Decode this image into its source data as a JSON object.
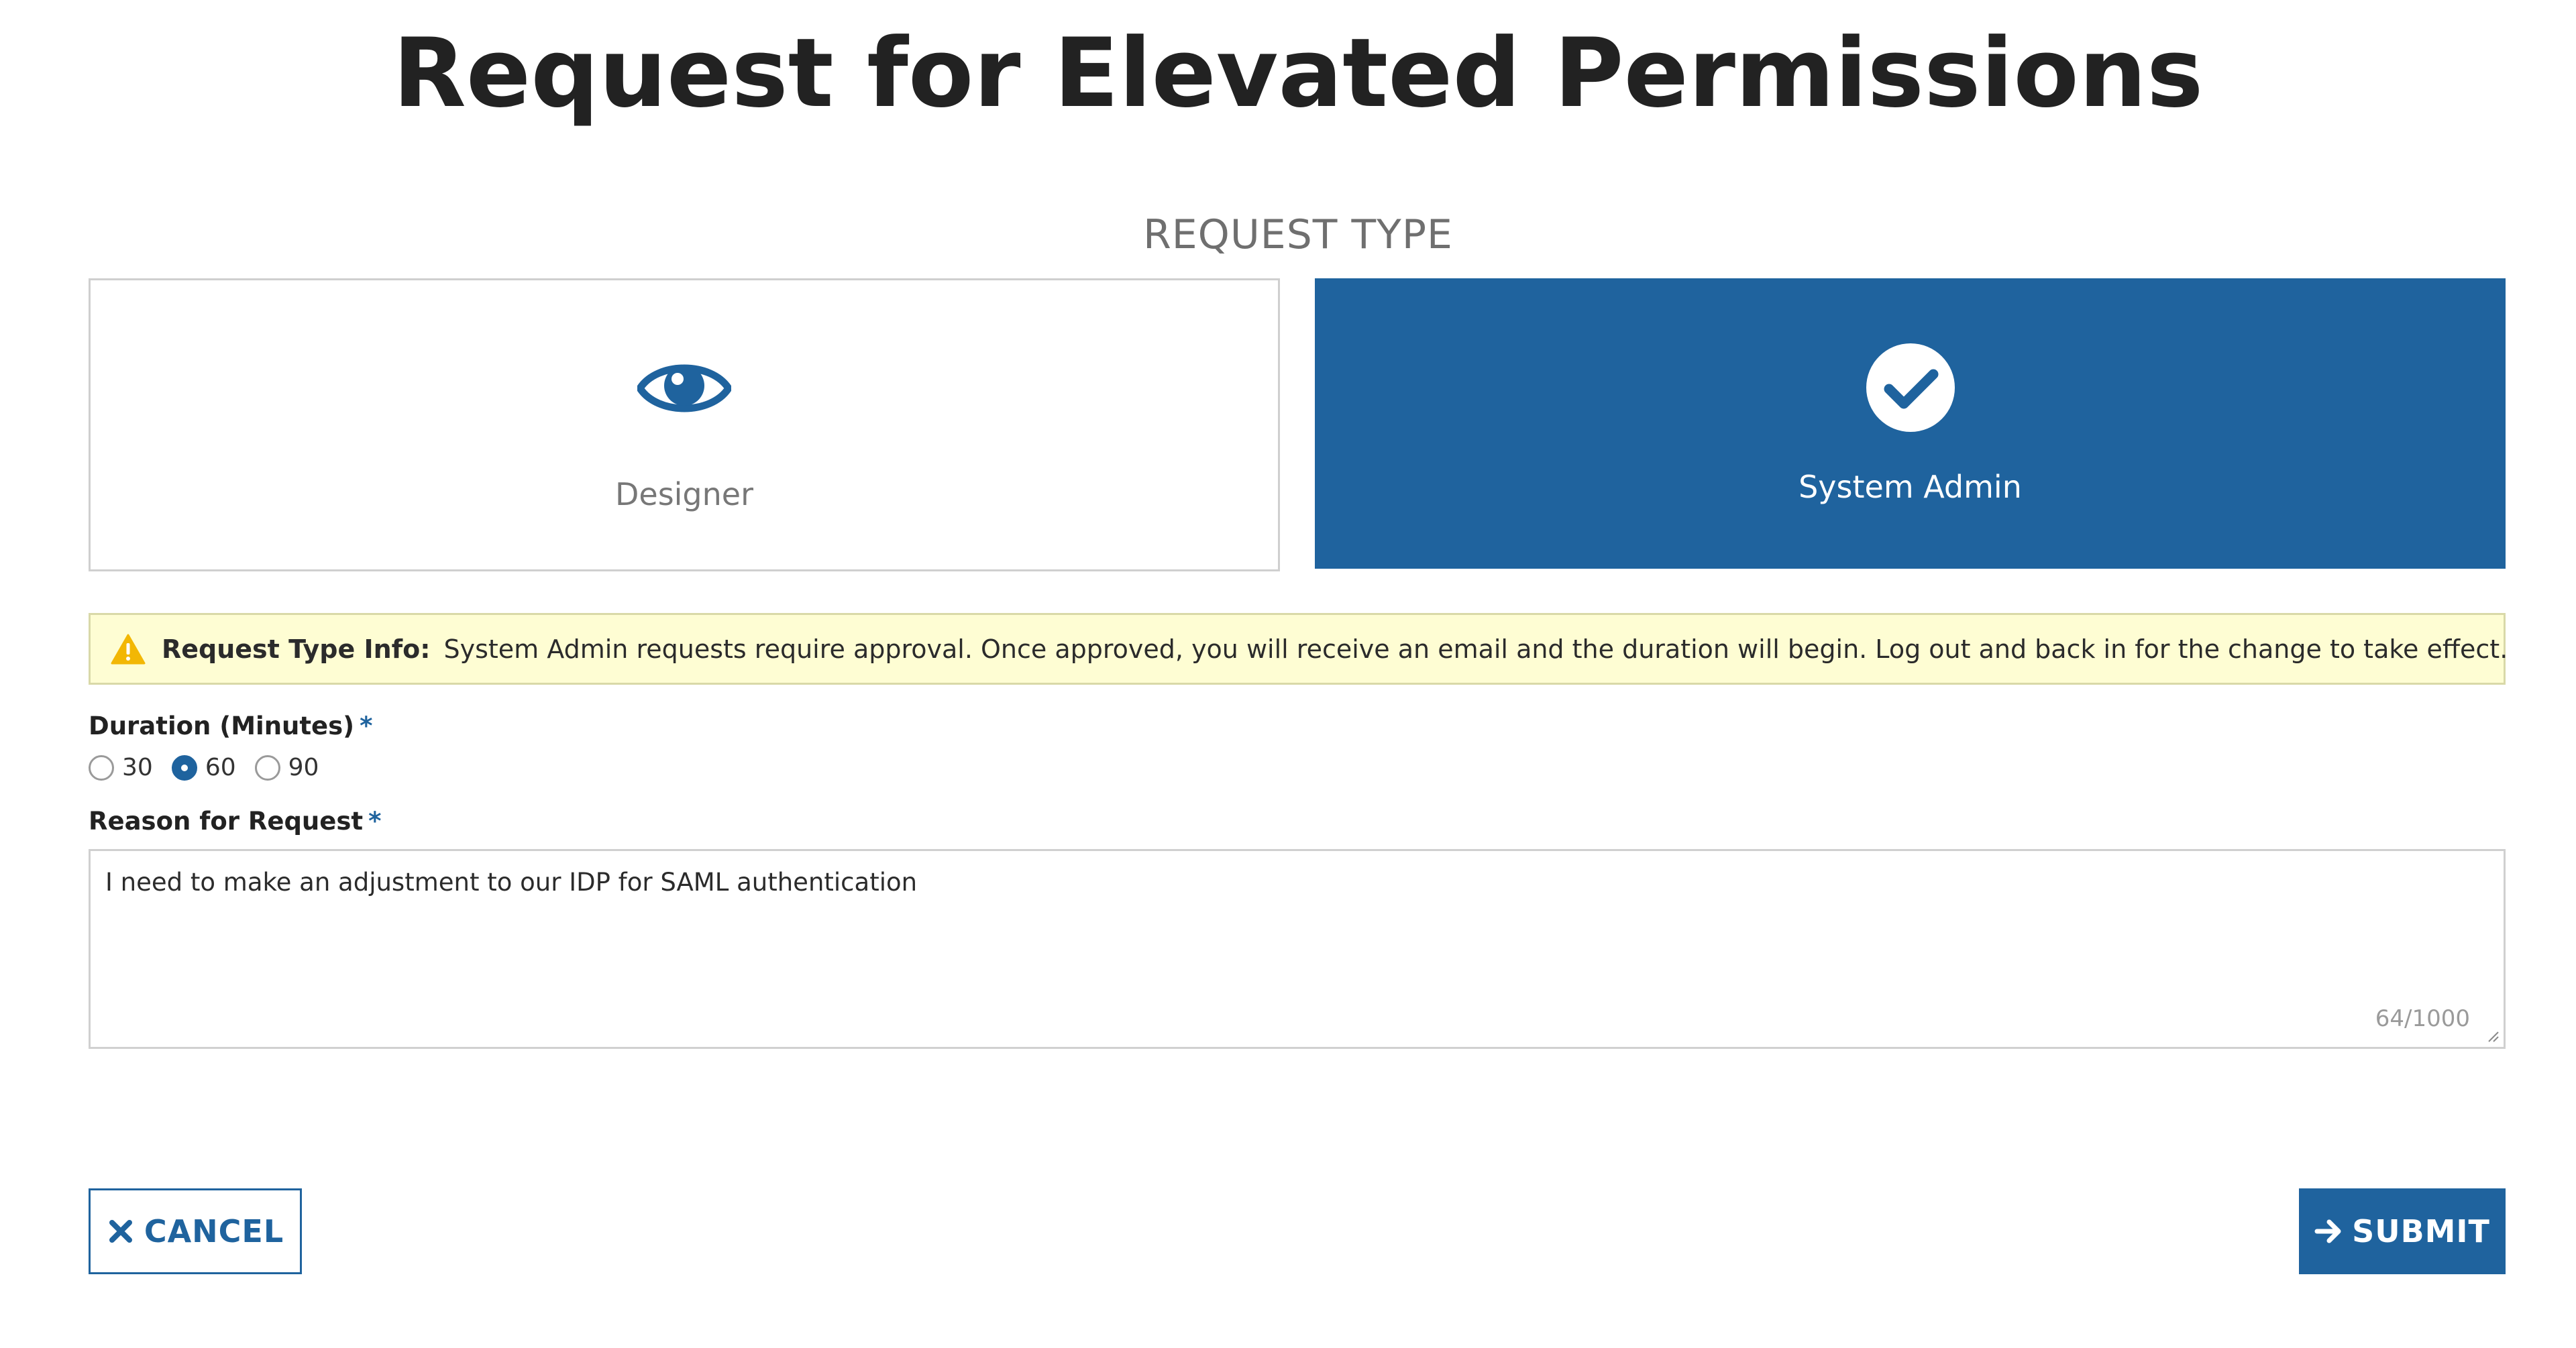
{
  "page": {
    "title": "Request for Elevated Permissions"
  },
  "request_type": {
    "section_label": "REQUEST TYPE",
    "options": [
      {
        "label": "Designer",
        "icon": "eye-icon",
        "selected": false
      },
      {
        "label": "System Admin",
        "icon": "check-circle-icon",
        "selected": true
      }
    ]
  },
  "info": {
    "icon": "warning-icon",
    "label": "Request Type Info:",
    "text": "System Admin requests require approval.  Once approved, you will receive an email and the duration will begin. Log out and back in for the change to take effect."
  },
  "duration": {
    "label": "Duration (Minutes)",
    "required_mark": "*",
    "options": [
      {
        "label": "30",
        "selected": false
      },
      {
        "label": "60",
        "selected": true
      },
      {
        "label": "90",
        "selected": false
      }
    ]
  },
  "reason": {
    "label": "Reason for Request",
    "required_mark": "*",
    "value": "I need to make an adjustment to our IDP for SAML authentication",
    "char_count": "64/1000"
  },
  "actions": {
    "cancel_label": "CANCEL",
    "cancel_icon": "close-icon",
    "submit_label": "SUBMIT",
    "submit_icon": "arrow-right-icon"
  },
  "colors": {
    "primary": "#1f639e",
    "info_background": "#fefdd3",
    "warning": "#f2b705",
    "text": "#222222",
    "muted": "#777777"
  }
}
